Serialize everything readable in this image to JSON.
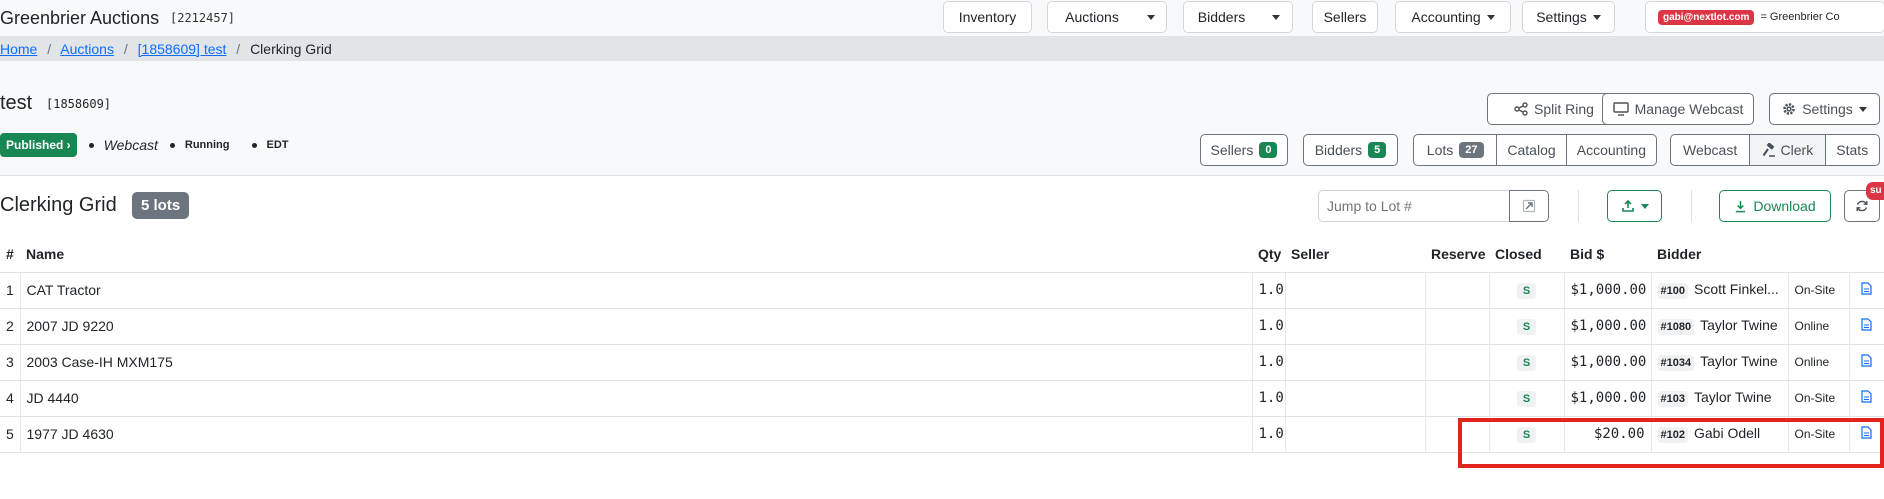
{
  "app": {
    "title": "Greenbrier Auctions",
    "id": "[2212457]"
  },
  "nav": {
    "inventory": "Inventory",
    "auctions": "Auctions",
    "bidders": "Bidders",
    "sellers": "Sellers",
    "accounting": "Accounting",
    "settings": "Settings",
    "user_email": "gabi@nextlot.com",
    "org": "= Greenbrier Co"
  },
  "breadcrumb": {
    "home": "Home",
    "auctions": "Auctions",
    "auction": "[1858609] test",
    "current": "Clerking Grid",
    "sep": "/"
  },
  "auction": {
    "title": "test",
    "id": "[1858609]",
    "status": "Published ›",
    "type": "Webcast",
    "state": "Running",
    "timezone": "EDT"
  },
  "actions": {
    "split_ring": "Split Ring",
    "manage_webcast": "Manage Webcast",
    "settings": "Settings"
  },
  "tabs": {
    "sellers": "Sellers",
    "sellers_count": "0",
    "bidders": "Bidders",
    "bidders_count": "5",
    "lots": "Lots",
    "lots_count": "27",
    "catalog": "Catalog",
    "accounting": "Accounting",
    "webcast": "Webcast",
    "clerk": "Clerk",
    "stats": "Stats"
  },
  "grid": {
    "title": "Clerking Grid",
    "lots_badge": "5 lots",
    "jump_placeholder": "Jump to Lot #",
    "download": "Download",
    "sub_badge": "su",
    "columns": {
      "num": "#",
      "name": "Name",
      "qty": "Qty",
      "seller": "Seller",
      "reserve": "Reserve",
      "closed": "Closed",
      "bid": "Bid $",
      "bidder": "Bidder"
    },
    "rows": [
      {
        "num": "1",
        "name": "CAT Tractor",
        "qty": "1.0",
        "seller": "",
        "reserve": "",
        "closed": "S",
        "bid": "$1,000.00",
        "paddle": "#100",
        "bidder": "Scott Finkel...",
        "location": "On-Site"
      },
      {
        "num": "2",
        "name": "2007 JD 9220",
        "qty": "1.0",
        "seller": "",
        "reserve": "",
        "closed": "S",
        "bid": "$1,000.00",
        "paddle": "#1080",
        "bidder": "Taylor Twine",
        "location": "Online"
      },
      {
        "num": "3",
        "name": "2003 Case-IH MXM175",
        "qty": "1.0",
        "seller": "",
        "reserve": "",
        "closed": "S",
        "bid": "$1,000.00",
        "paddle": "#1034",
        "bidder": "Taylor Twine",
        "location": "Online"
      },
      {
        "num": "4",
        "name": "JD 4440",
        "qty": "1.0",
        "seller": "",
        "reserve": "",
        "closed": "S",
        "bid": "$1,000.00",
        "paddle": "#103",
        "bidder": "Taylor Twine",
        "location": "On-Site"
      },
      {
        "num": "5",
        "name": "1977 JD 4630",
        "qty": "1.0",
        "seller": "",
        "reserve": "",
        "closed": "S",
        "bid": "$20.00",
        "paddle": "#102",
        "bidder": "Gabi Odell",
        "location": "On-Site"
      }
    ]
  },
  "colors": {
    "primary": "#0d6efd",
    "success": "#198754",
    "danger": "#dc3545",
    "secondary": "#6c757d",
    "highlight": "#e4241b"
  }
}
